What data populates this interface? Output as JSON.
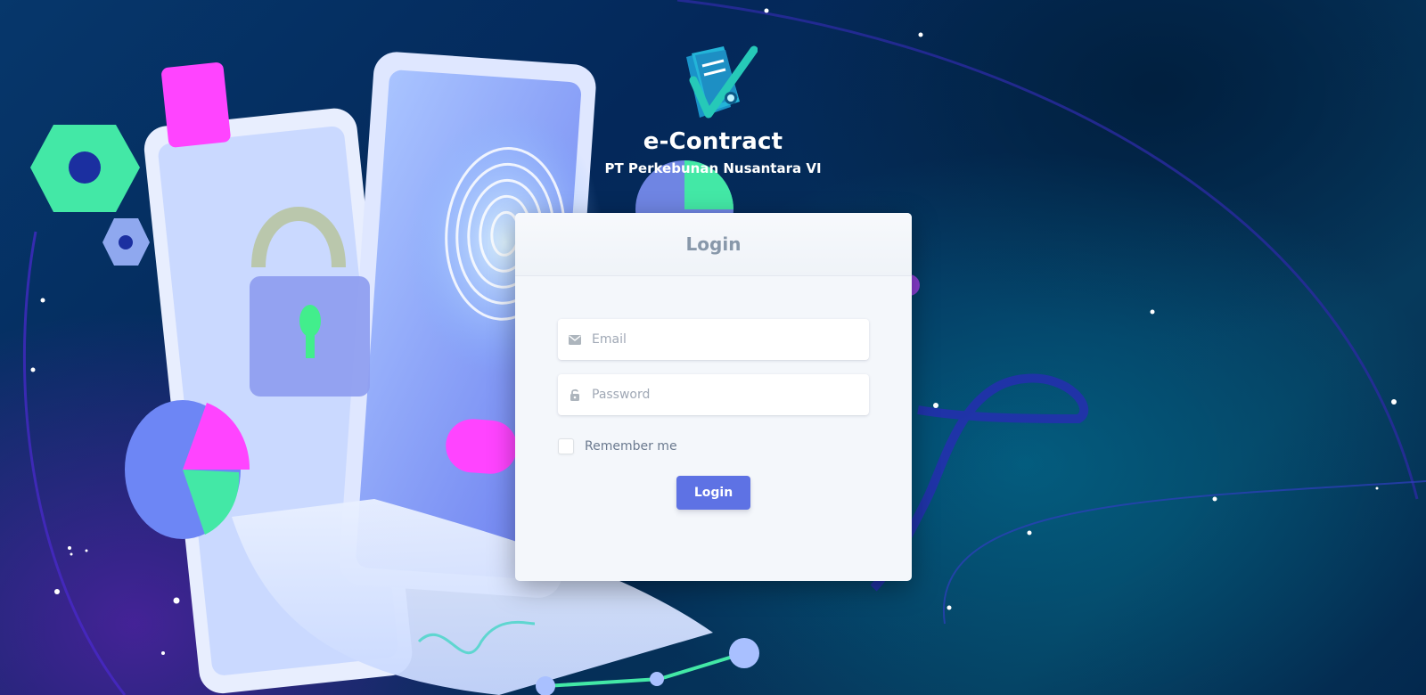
{
  "brand": {
    "logo_icon": "contract-document-icon",
    "title": "e-Contract",
    "subtitle": "PT Perkebunan Nusantara VI"
  },
  "login_card": {
    "title": "Login",
    "email": {
      "icon": "envelope-icon",
      "placeholder": "Email",
      "value": ""
    },
    "password": {
      "icon": "lock-icon",
      "placeholder": "Password",
      "value": ""
    },
    "remember_label": "Remember me",
    "remember_checked": false,
    "submit_label": "Login"
  },
  "colors": {
    "primary": "#5e72e4",
    "card_background": "#f4f7fb",
    "title_gray": "#8898aa",
    "page_background": "#04285a"
  }
}
